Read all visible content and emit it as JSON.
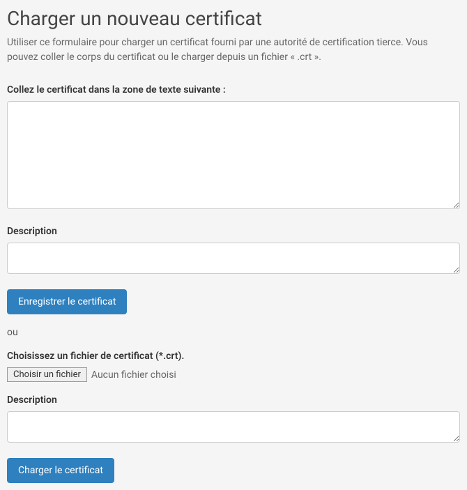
{
  "page": {
    "title": "Charger un nouveau certificat",
    "subtitle": "Utiliser ce formulaire pour charger un certificat fourni par une autorité de certification tierce. Vous pouvez coller le corps du certificat ou le charger depuis un fichier « .crt »."
  },
  "paste_section": {
    "label": "Collez le certificat dans la zone de texte suivante :",
    "value": "",
    "description_label": "Description",
    "description_value": "",
    "save_button": "Enregistrer le certificat"
  },
  "separator": "ou",
  "file_section": {
    "label": "Choisissez un fichier de certificat (*.crt).",
    "choose_button": "Choisir un fichier",
    "file_status": "Aucun fichier choisi",
    "description_label": "Description",
    "description_value": "",
    "upload_button": "Charger le certificat"
  }
}
